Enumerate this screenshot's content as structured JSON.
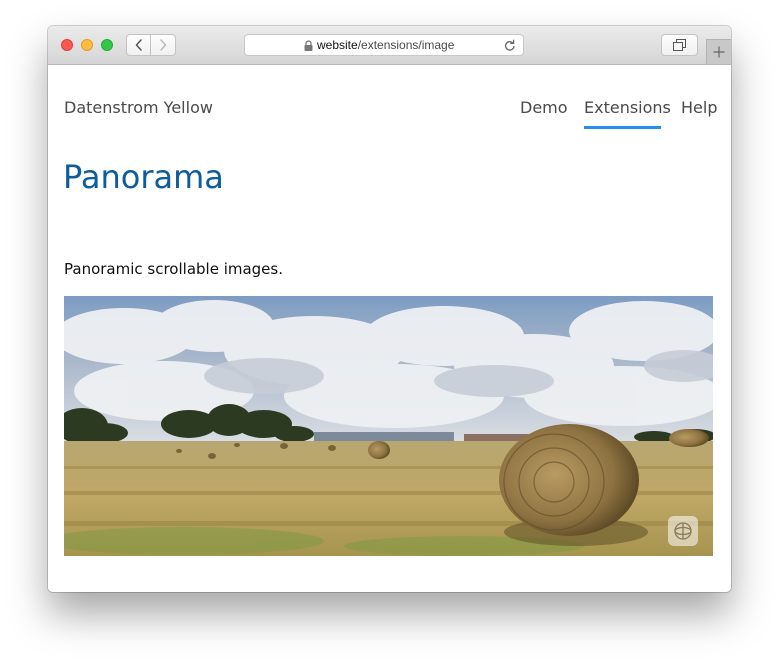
{
  "browser": {
    "address": {
      "host": "website",
      "path": "/extensions/image"
    },
    "icons": {
      "back": "chevron-left-icon",
      "forward": "chevron-right-icon",
      "lock": "lock-icon",
      "reload": "reload-icon",
      "tabs": "tabs-overview-icon",
      "new_tab": "plus-icon"
    },
    "colors": {
      "close": "#fc5753",
      "minimize": "#fdbc40",
      "zoom": "#33c748"
    }
  },
  "site": {
    "title": "Datenstrom Yellow",
    "nav": [
      {
        "label": "Demo",
        "active": false
      },
      {
        "label": "Extensions",
        "active": true
      },
      {
        "label": "Help",
        "active": false
      }
    ],
    "accent": "#2a8ef0"
  },
  "page": {
    "title": "Panorama",
    "title_color": "#0d5c9d",
    "description": "Panoramic scrollable images.",
    "panorama": {
      "control_icon": "panorama-rotate-icon"
    }
  }
}
